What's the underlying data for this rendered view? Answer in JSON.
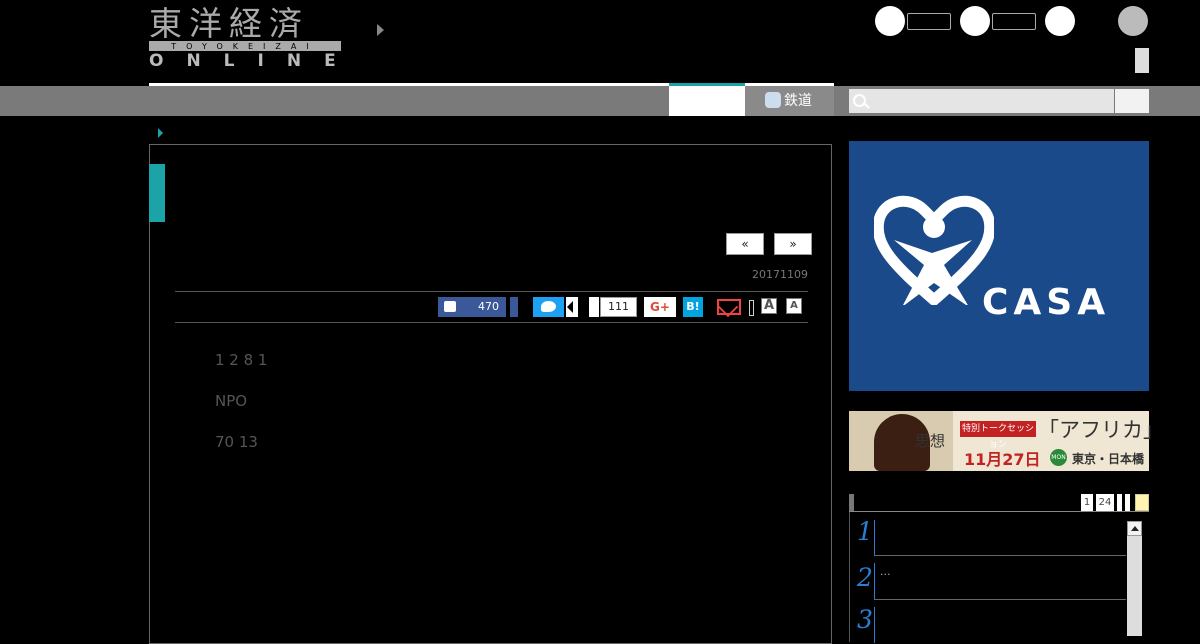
{
  "header": {
    "logo_kanji": "東洋経済",
    "logo_band": "TOYOKEIZAI",
    "logo_online": "ONLINE"
  },
  "nav": {
    "rail_label": "鉄道",
    "search_placeholder": ""
  },
  "article": {
    "prev_label": "«",
    "next_label": "»",
    "date": "20171109",
    "facebook_count": "470",
    "share_count": "111",
    "gplus_label": "G+",
    "hatena_label": "B!",
    "font_large": "A",
    "font_small": "A",
    "paragraphs": [
      "1 2 8 1",
      "NPO",
      "70 13"
    ]
  },
  "sidebar": {
    "ad_casa_text": "CASA",
    "ad_africa": {
      "band": "特別トークセッション",
      "title": "「アフリカ」",
      "date": "11月27日",
      "day": "MON",
      "place": "東京・日本橋",
      "photo_label": "思想"
    },
    "ranking_tabs": [
      "1",
      "24"
    ],
    "ranking": [
      {
        "num": "1",
        "text": ""
      },
      {
        "num": "2",
        "text": "..."
      },
      {
        "num": "3",
        "text": ""
      }
    ]
  },
  "colors": {
    "accent": "#1ba3a8",
    "facebook": "#3b5998",
    "twitter": "#1da1f2",
    "hatena": "#00a4de",
    "casa_blue": "#1b4a8a"
  }
}
